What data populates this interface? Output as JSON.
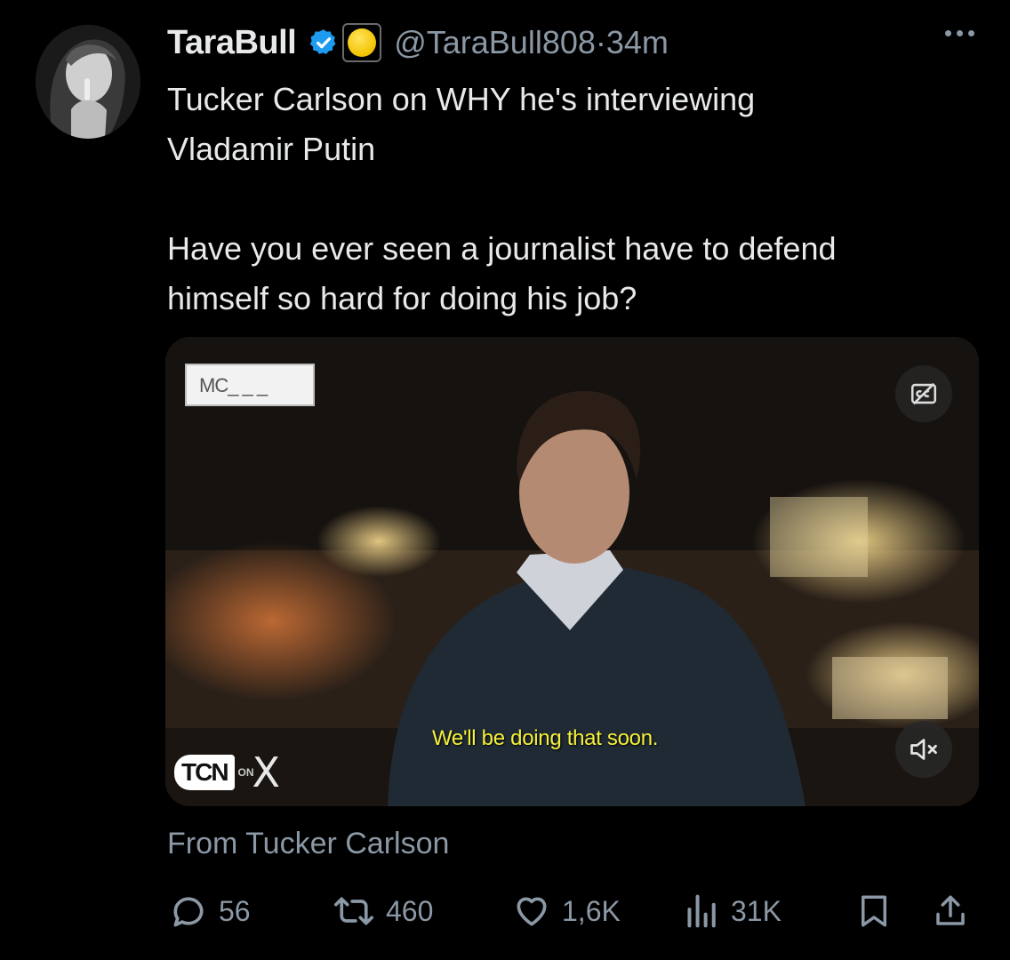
{
  "tweet": {
    "author_name": "TaraBull",
    "handle": "@TaraBull808",
    "separator": "·",
    "time": "34m",
    "text_line_1": "Tucker Carlson on WHY he's interviewing\nVladamir Putin",
    "text_line_2": "Have you ever seen a journalist have to defend\nhimself so hard for doing his job?"
  },
  "media": {
    "corner_label": "MC_ _ _",
    "subtitle": "We'll be doing that soon.",
    "logo_text": "TCN",
    "logo_on": "ON",
    "logo_x": "X",
    "attribution": "From Tucker Carlson"
  },
  "actions": {
    "replies": "56",
    "reposts": "460",
    "likes": "1,6K",
    "views": "31K"
  },
  "colors": {
    "background": "#000000",
    "text": "#e7e9ea",
    "muted": "#8b98a5",
    "verified": "#1d9bf0",
    "subtitle": "#f5f03a"
  },
  "icons": [
    "more-icon",
    "verified-icon",
    "affiliate-badge-icon",
    "captions-icon",
    "mute-icon",
    "reply-icon",
    "repost-icon",
    "like-icon",
    "views-icon",
    "bookmark-icon",
    "share-icon"
  ]
}
